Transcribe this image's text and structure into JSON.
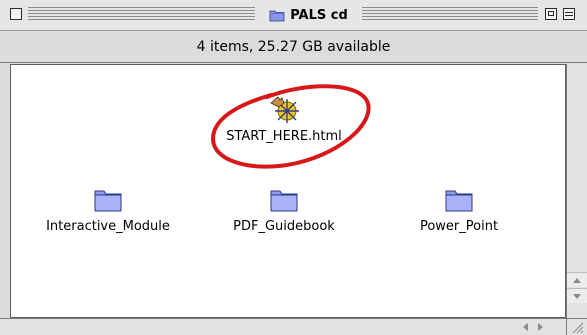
{
  "window": {
    "title": "PALS cd",
    "title_icon": "cd-folder-icon",
    "status_text": "4 items, 25.27 GB available"
  },
  "items": [
    {
      "label": "START_HERE.html",
      "icon": "web-document-icon",
      "annotated": true,
      "annotation_color": "#d7181b"
    },
    {
      "label": "Interactive_Module",
      "icon": "folder-icon"
    },
    {
      "label": "PDF_Guidebook",
      "icon": "folder-icon"
    },
    {
      "label": "Power_Point",
      "icon": "folder-icon"
    }
  ],
  "colors": {
    "folder": "#9aa6f0",
    "window_chrome": "#dcdcdc",
    "content_bg": "#ffffff"
  }
}
